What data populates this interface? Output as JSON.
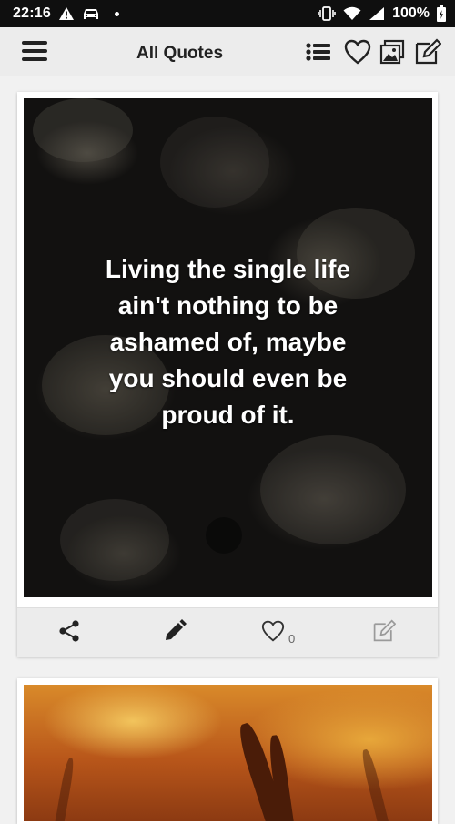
{
  "status_bar": {
    "time": "22:16",
    "battery": "100%"
  },
  "app_bar": {
    "title": "All Quotes",
    "icons": [
      "menu-icon",
      "list-icon",
      "heart-icon",
      "image-icon",
      "edit-icon"
    ]
  },
  "quote_card": {
    "text_lines": [
      "Living the single life",
      "ain't nothing to be",
      "ashamed of, maybe",
      "you should even be",
      "proud of it."
    ],
    "like_count": "0",
    "actions": [
      "share-icon",
      "pencil-icon",
      "heart-icon",
      "report-icon"
    ]
  },
  "colors": {
    "status_bar_bg": "#0f0f0f",
    "app_bar_bg": "#ececec",
    "page_bg": "#f1f1f1",
    "card_bg": "#ffffff",
    "quote_text": "#ffffff"
  }
}
